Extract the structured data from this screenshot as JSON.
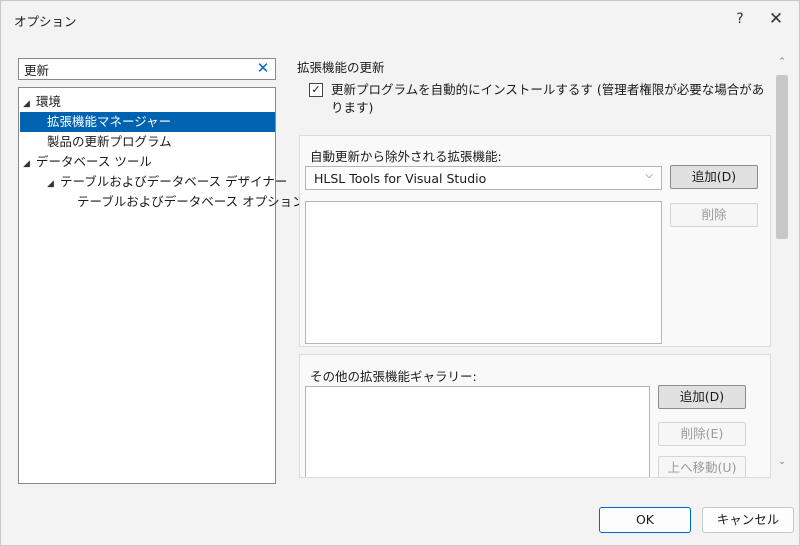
{
  "window": {
    "title": "オプション",
    "help_label": "?",
    "close_label": "✕"
  },
  "search": {
    "value": "更新",
    "clear_label": "✕"
  },
  "tree": {
    "items": [
      {
        "arrow": "◢",
        "label": "環境"
      },
      {
        "arrow": "",
        "label": "拡張機能マネージャー"
      },
      {
        "arrow": "",
        "label": "製品の更新プログラム"
      },
      {
        "arrow": "◢",
        "label": "データベース ツール"
      },
      {
        "arrow": "◢",
        "label": "テーブルおよびデータベース デザイナー"
      },
      {
        "arrow": "",
        "label": "テーブルおよびデータベース オプション"
      }
    ]
  },
  "content": {
    "section_title": "拡張機能の更新",
    "auto_install": {
      "checked": true,
      "check_mark": "✓",
      "label": "更新プログラムを自動的にインストールするす (管理者権限が必要な場合があります)"
    },
    "excluded": {
      "label": "自動更新から除外される拡張機能:",
      "combo_value": "HLSL Tools for Visual Studio",
      "combo_arrow": "⌵",
      "add_label": "追加(D)",
      "delete_label": "削除"
    },
    "galleries": {
      "label": "その他の拡張機能ギャラリー:",
      "add_label": "追加(D)",
      "delete_label": "削除(E)",
      "move_up_label": "上へ移動(U)"
    },
    "scroll_up_glyph": "⌃",
    "scroll_down_glyph": "⌄"
  },
  "footer": {
    "ok_label": "OK",
    "cancel_label": "キャンセル"
  }
}
